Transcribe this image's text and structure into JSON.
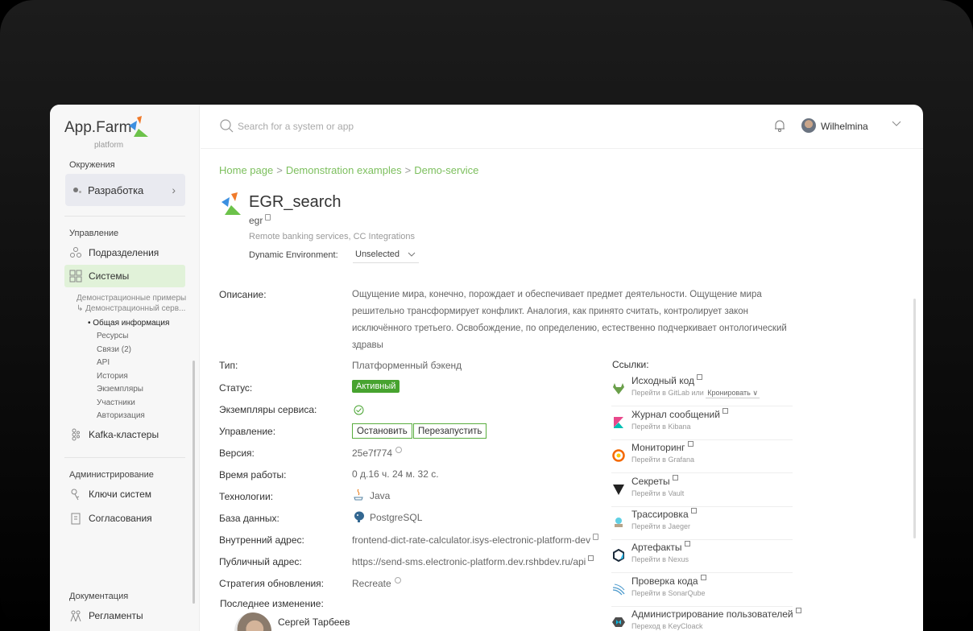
{
  "app": {
    "logo_word": "App.Farm",
    "logo_sub": "platform"
  },
  "sidebar": {
    "env_section": "Окружения",
    "env_current": "Разработка",
    "manage_section": "Управление",
    "items_manage": [
      {
        "label": "Подразделения"
      },
      {
        "label": "Системы"
      }
    ],
    "tree_line1": "Демонстрационные примеры",
    "tree_line2": "↳ Демонстрационный серв...",
    "subitems": [
      "• Общая информация",
      "Ресурсы",
      "Связи (2)",
      "API",
      "История",
      "Экземпляры",
      "Участники",
      "Авторизация"
    ],
    "kafka": "Kafka-кластеры",
    "admin_section": "Администрирование",
    "items_admin": [
      {
        "label": "Ключи систем"
      },
      {
        "label": "Согласования"
      }
    ],
    "docs_section": "Документация",
    "docs_item": "Регламенты"
  },
  "header": {
    "search_placeholder": "Search for a system or app",
    "user_name": "Wilhelmina"
  },
  "breadcrumb": {
    "home": "Home page",
    "level2": "Demonstration examples",
    "level3": "Demo-service"
  },
  "service": {
    "title": "EGR_search",
    "code": "egr",
    "tags": "Remote banking services, CC Integrations",
    "dyn_label": "Dynamic Environment:",
    "dyn_value": "Unselected"
  },
  "fields": {
    "desc_label": "Описание:",
    "desc_text": "Ощущение мира, конечно, порождает и обеспечивает предмет деятельности. Ощущение мира решительно трансформирует конфликт. Аналогия, как принято считать, контролирует закон исключённого третьего. Освобождение, по определению, естественно подчеркивает онтологический здравы",
    "type_label": "Тип:",
    "type_value": "Платформенный бэкенд",
    "status_label": "Статус:",
    "status_value": "Активный",
    "instances_label": "Экземпляры сервиса:",
    "control_label": "Управление:",
    "btn_stop": "Остановить",
    "btn_restart": "Перезапустить",
    "version_label": "Версия:",
    "version_value": "25e7f774",
    "uptime_label": "Время работы:",
    "uptime_value": "0 д.16 ч. 24 м. 32 с.",
    "tech_label": "Технологии:",
    "tech_value": "Java",
    "db_label": "База данных:",
    "db_value": "PostgreSQL",
    "internal_label": "Внутренний адрес:",
    "internal_value": "frontend-dict-rate-calculator.isys-electronic-platform-dev",
    "public_label": "Публичный адрес:",
    "public_value": "https://send-sms.electronic-platform.dev.rshbdev.ru/api",
    "strategy_label": "Стратегия обновления:",
    "strategy_value": "Recreate",
    "lastchange_label": "Последнее изменение:",
    "lastchange_person": "Сергей Тарбеев"
  },
  "links": {
    "title": "Ссылки:",
    "items": [
      {
        "title": "Исходный код",
        "sub": "Перейти в GitLab или",
        "extra": "Кронировать"
      },
      {
        "title": "Журнал сообщений",
        "sub": "Перейти в Kibana"
      },
      {
        "title": "Мониторинг",
        "sub": "Перейти в Grafana"
      },
      {
        "title": "Секреты",
        "sub": "Перейти в Vault"
      },
      {
        "title": "Трассировка",
        "sub": "Перейти в Jaeger"
      },
      {
        "title": "Артефакты",
        "sub": "Перейти в Nexus"
      },
      {
        "title": "Проверка кода",
        "sub": "Перейти в SonarQube"
      },
      {
        "title": "Администрирование пользователей",
        "sub": "Переход в KeyCloack"
      }
    ]
  },
  "colors": {
    "accent_green": "#47a32f",
    "breadcrumb_green": "#7cbf5d",
    "active_bg": "#e1f2d9"
  }
}
